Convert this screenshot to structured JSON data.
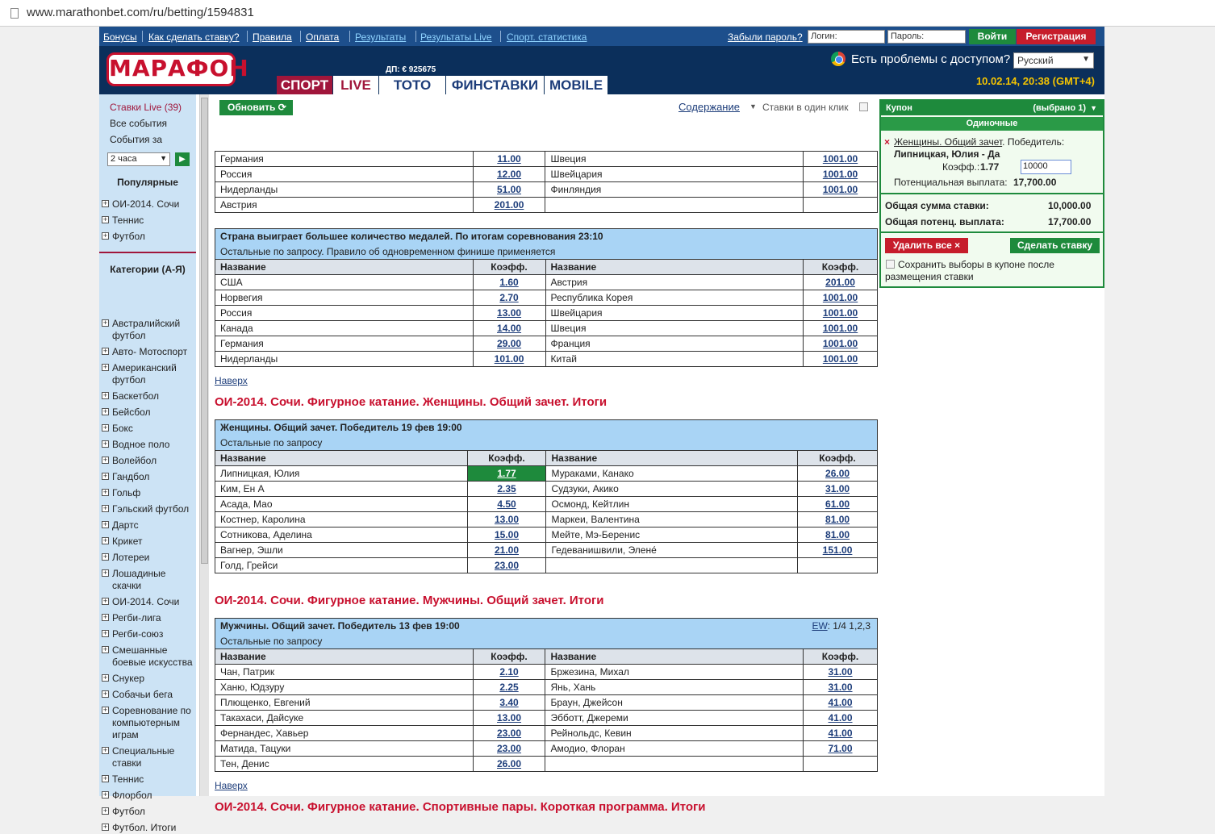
{
  "browser": {
    "url": "www.marathonbet.com/ru/betting/1594831"
  },
  "topnav": {
    "links": [
      "Бонусы",
      "Как сделать ставку?",
      "Правила",
      "Оплата",
      "Результаты",
      "Результаты Live",
      "Спорт. статистика"
    ],
    "forgot": "Забыли пароль?",
    "login_placeholder": "Логин:",
    "password_placeholder": "Пароль:",
    "login_button": "Войти",
    "register_button": "Регистрация"
  },
  "header": {
    "logo": "МАРАФОН",
    "dp": "ДП: € 925675",
    "tabs": [
      "СПОРТ",
      "LIVE",
      "ТОТО",
      "ФИНСТАВКИ",
      "MOBILE"
    ],
    "access": "Есть проблемы с доступом?",
    "language": "Русский",
    "datetime": "10.02.14, 20:38 (GMT+4)"
  },
  "sidebar": {
    "live": "Ставки Live (39)",
    "all_events": "Все события",
    "events_for": "События за",
    "period": "2 часа",
    "popular_title": "Популярные",
    "popular": [
      "ОИ-2014. Сочи",
      "Теннис",
      "Футбол"
    ],
    "categories_title": "Категории (А-Я)",
    "categories": [
      "Австралийский футбол",
      "Авто- Мотоспорт",
      "Американский футбол",
      "Баскетбол",
      "Бейсбол",
      "Бокс",
      "Водное поло",
      "Волейбол",
      "Гандбол",
      "Гольф",
      "Гэльский футбол",
      "Дартс",
      "Крикет",
      "Лотереи",
      "Лошадиные скачки",
      "ОИ-2014. Сочи",
      "Регби-лига",
      "Регби-союз",
      "Смешанные боевые искусства",
      "Снукер",
      "Собачьи бега",
      "Соревнование по компьютерным играм",
      "Специальные ставки",
      "Теннис",
      "Флорбол",
      "Футбол",
      "Футбол. Итоги"
    ]
  },
  "main": {
    "refresh": "Обновить",
    "contents": "Содержание",
    "one_click": "Ставки в один клик",
    "top_link": "Наверх",
    "table0": {
      "rows": [
        [
          "Германия",
          "11.00",
          "Швеция",
          "1001.00"
        ],
        [
          "Россия",
          "12.00",
          "Швейцария",
          "1001.00"
        ],
        [
          "Нидерланды",
          "51.00",
          "Финляндия",
          "1001.00"
        ],
        [
          "Австрия",
          "201.00",
          "",
          ""
        ]
      ]
    },
    "table1": {
      "title": "Страна выиграет большее количество медалей. По итогам соревнования  23:10",
      "subtitle": "Остальные по запросу. Правило об одновременном финише применяется",
      "headers": [
        "Название",
        "Коэфф.",
        "Название",
        "Коэфф."
      ],
      "rows": [
        [
          "США",
          "1.60",
          "Австрия",
          "201.00"
        ],
        [
          "Норвегия",
          "2.70",
          "Республика Корея",
          "1001.00"
        ],
        [
          "Россия",
          "13.00",
          "Швейцария",
          "1001.00"
        ],
        [
          "Канада",
          "14.00",
          "Швеция",
          "1001.00"
        ],
        [
          "Германия",
          "29.00",
          "Франция",
          "1001.00"
        ],
        [
          "Нидерланды",
          "101.00",
          "Китай",
          "1001.00"
        ]
      ]
    },
    "section2": "ОИ-2014. Сочи. Фигурное катание. Женщины. Общий зачет. Итоги",
    "table2": {
      "title": "Женщины. Общий зачет. Победитель  19 фев 19:00",
      "subtitle": "Остальные по запросу",
      "headers": [
        "Название",
        "Коэфф.",
        "Название",
        "Коэфф."
      ],
      "rows": [
        [
          "Липницкая, Юлия",
          "1.77",
          "Мураками, Канако",
          "26.00"
        ],
        [
          "Ким, Ен А",
          "2.35",
          "Судзуки, Акико",
          "31.00"
        ],
        [
          "Асада, Мао",
          "4.50",
          "Осмонд, Кейтлин",
          "61.00"
        ],
        [
          "Костнер, Каролина",
          "13.00",
          "Маркеи, Валентина",
          "81.00"
        ],
        [
          "Сотникова, Аделина",
          "15.00",
          "Мейте, Мэ-Беренис",
          "81.00"
        ],
        [
          "Вагнер, Эшли",
          "21.00",
          "Гедеванишвили, Элене́",
          "151.00"
        ],
        [
          "Голд, Грейси",
          "23.00",
          "",
          ""
        ]
      ]
    },
    "section3": "ОИ-2014. Сочи. Фигурное катание. Мужчины. Общий зачет. Итоги",
    "table3": {
      "title": "Мужчины. Общий зачет. Победитель  13 фев 19:00",
      "ew_link": "EW",
      "ew_text": ": 1/4 1,2,3",
      "subtitle": "Остальные по запросу",
      "headers": [
        "Название",
        "Коэфф.",
        "Название",
        "Коэфф."
      ],
      "rows": [
        [
          "Чан, Патрик",
          "2.10",
          "Бржезина, Михал",
          "31.00"
        ],
        [
          "Ханю, Юдзуру",
          "2.25",
          "Янь, Хань",
          "31.00"
        ],
        [
          "Плющенко, Евгений",
          "3.40",
          "Браун, Джейсон",
          "41.00"
        ],
        [
          "Такахаси, Дайсуке",
          "13.00",
          "Эбботт, Джереми",
          "41.00"
        ],
        [
          "Фернандес, Хавьер",
          "23.00",
          "Рейнольдс, Кевин",
          "41.00"
        ],
        [
          "Матида, Тацуки",
          "23.00",
          "Амодио, Флоран",
          "71.00"
        ],
        [
          "Тен, Денис",
          "26.00",
          "",
          ""
        ]
      ]
    },
    "section4": "ОИ-2014. Сочи. Фигурное катание. Спортивные пары. Короткая программа. Итоги"
  },
  "coupon": {
    "title": "Купон",
    "selected": "(выбрано 1)",
    "single": "Одиночные",
    "remove_mark": "×",
    "bet_link": "Женщины. Общий зачет",
    "bet_rest": ". Победитель:",
    "bet_pick": "Липницкая, Юлия - Да",
    "odds_label": "Коэфф.:",
    "odds_value": "1.77",
    "stake": "10000",
    "potential_label": "Потенциальная выплата:",
    "potential_value": "17,700.00",
    "total_stake_label": "Общая сумма ставки:",
    "total_stake_value": "10,000.00",
    "total_payout_label": "Общая потенц. выплата:",
    "total_payout_value": "17,700.00",
    "remove_all": "Удалить все",
    "place_bet": "Сделать ставку",
    "keep_label": "Сохранить выборы в купоне после размещения ставки"
  },
  "colors": {
    "brand_blue": "#0b2f5b",
    "accent_red": "#c8102e",
    "green": "#1e8a3c",
    "caption_blue": "#a9d4f5"
  }
}
